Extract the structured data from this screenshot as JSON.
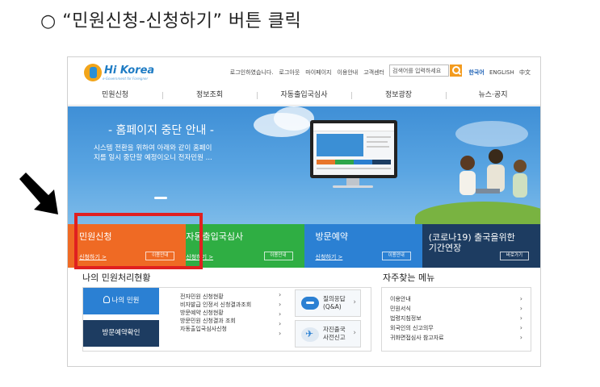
{
  "instruction": "○ “민원신청-신청하기” 버튼 클릭",
  "header": {
    "logo_text": "Hi Korea",
    "logo_sub": "e-Government for Foreigner",
    "util_links": [
      "로그인하였습니다.",
      "로그아웃",
      "마이페이지",
      "이용안내",
      "고객센터"
    ],
    "search_placeholder": "검색어를 입력하세요",
    "languages": [
      "한국어",
      "ENGLISH",
      "中文"
    ]
  },
  "nav": [
    "민원신청",
    "정보조회",
    "자동출입국심사",
    "정보광장",
    "뉴스·공지"
  ],
  "banner": {
    "title": "- 홈페이지 중단 안내 -",
    "desc_line1": "시스템 전환을 위하여 아래와 같이 홈페이",
    "desc_line2": "지를 일시 중단할 예정이오니 전자민원 ..."
  },
  "tiles": [
    {
      "title": "민원신청",
      "link": "신청하기 >",
      "button": "이용안내"
    },
    {
      "title": "자동출입국심사",
      "link": "신청하기 >",
      "button": "이용안내"
    },
    {
      "title": "방문예약",
      "link": "신청하기 >",
      "button": "이용안내"
    },
    {
      "title_line1": "(코로나19) 출국을위한",
      "title_line2": "기간연장",
      "button": "바로가기"
    }
  ],
  "status": {
    "title": "나의 민원처리현황",
    "my_civil": "나의 민원",
    "visit_check": "방문예약확인",
    "links": [
      "전자민원 신청현황",
      "비자발급 인정서 신청결과조회",
      "방문예약 신청현황",
      "방문민원 신청결과 조회",
      "자동출입국심사신청"
    ],
    "qa_line1": "질의응답",
    "qa_line2": "(Q&A)",
    "departure_line1": "자진출국",
    "departure_line2": "사전신고"
  },
  "faq": {
    "title": "자주찾는 메뉴",
    "items": [
      "이용안내",
      "민원서식",
      "법령지침정보",
      "외국인의 신고의무",
      "귀화면접심사 참고자료"
    ]
  },
  "colors": {
    "tile_orange": "#ef6a24",
    "tile_green": "#2fae43",
    "tile_blue": "#2b80d3",
    "tile_navy": "#1d3c61",
    "highlight_red": "#e02020"
  }
}
